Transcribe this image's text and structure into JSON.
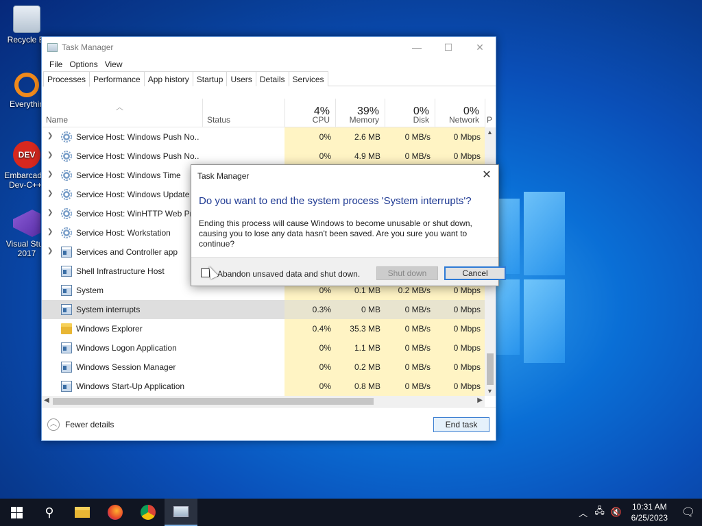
{
  "desktop": {
    "icons": [
      {
        "label": "Recycle Bi",
        "icon": "recycle-bin-icon"
      },
      {
        "label": "Everythin",
        "icon": "everything-search-icon"
      },
      {
        "label": "Embarcade Dev-C++",
        "icon": "devcpp-icon"
      },
      {
        "label": "Visual Stud 2017",
        "icon": "visual-studio-icon"
      }
    ]
  },
  "window": {
    "title": "Task Manager",
    "controls": {
      "minimize": "—",
      "maximize": "☐",
      "close": "✕"
    },
    "menu": [
      "File",
      "Options",
      "View"
    ],
    "tabs": [
      "Processes",
      "Performance",
      "App history",
      "Startup",
      "Users",
      "Details",
      "Services"
    ],
    "active_tab": "Processes",
    "columns": {
      "name": "Name",
      "status": "Status",
      "cpu": {
        "pct": "4%",
        "label": "CPU"
      },
      "memory": {
        "pct": "39%",
        "label": "Memory"
      },
      "disk": {
        "pct": "0%",
        "label": "Disk"
      },
      "network": {
        "pct": "0%",
        "label": "Network"
      },
      "power_partial": "P"
    },
    "rows": [
      {
        "name": "Service Host: Windows Push No...",
        "icon": "gear-icon",
        "expandable": true,
        "cpu": "0%",
        "mem": "2.6 MB",
        "disk": "0 MB/s",
        "net": "0 Mbps"
      },
      {
        "name": "Service Host: Windows Push No...",
        "icon": "gear-icon",
        "expandable": true,
        "cpu": "0%",
        "mem": "4.9 MB",
        "disk": "0 MB/s",
        "net": "0 Mbps"
      },
      {
        "name": "Service Host: Windows Time",
        "icon": "gear-icon",
        "expandable": true,
        "cpu": "",
        "mem": "",
        "disk": "",
        "net": ""
      },
      {
        "name": "Service Host: Windows Update",
        "icon": "gear-icon",
        "expandable": true,
        "cpu": "",
        "mem": "",
        "disk": "",
        "net": ""
      },
      {
        "name": "Service Host: WinHTTP Web Pro",
        "icon": "gear-icon",
        "expandable": true,
        "cpu": "",
        "mem": "",
        "disk": "",
        "net": ""
      },
      {
        "name": "Service Host: Workstation",
        "icon": "gear-icon",
        "expandable": true,
        "cpu": "",
        "mem": "",
        "disk": "",
        "net": ""
      },
      {
        "name": "Services and Controller app",
        "icon": "window-icon",
        "expandable": true,
        "cpu": "",
        "mem": "",
        "disk": "",
        "net": ""
      },
      {
        "name": "Shell Infrastructure Host",
        "icon": "window-icon",
        "expandable": false,
        "cpu": "",
        "mem": "",
        "disk": "",
        "net": ""
      },
      {
        "name": "System",
        "icon": "window-icon",
        "expandable": false,
        "cpu": "0%",
        "mem": "0.1 MB",
        "disk": "0.2 MB/s",
        "net": "0 Mbps"
      },
      {
        "name": "System interrupts",
        "icon": "window-icon",
        "expandable": false,
        "selected": true,
        "cpu": "0.3%",
        "mem": "0 MB",
        "disk": "0 MB/s",
        "net": "0 Mbps"
      },
      {
        "name": "Windows Explorer",
        "icon": "folder-icon",
        "expandable": false,
        "cpu": "0.4%",
        "mem": "35.3 MB",
        "disk": "0 MB/s",
        "net": "0 Mbps"
      },
      {
        "name": "Windows Logon Application",
        "icon": "window-icon",
        "expandable": false,
        "cpu": "0%",
        "mem": "1.1 MB",
        "disk": "0 MB/s",
        "net": "0 Mbps"
      },
      {
        "name": "Windows Session Manager",
        "icon": "window-icon",
        "expandable": false,
        "cpu": "0%",
        "mem": "0.2 MB",
        "disk": "0 MB/s",
        "net": "0 Mbps"
      },
      {
        "name": "Windows Start-Up Application",
        "icon": "window-icon",
        "expandable": false,
        "cpu": "0%",
        "mem": "0.8 MB",
        "disk": "0 MB/s",
        "net": "0 Mbps"
      }
    ],
    "footer": {
      "fewer_details": "Fewer details",
      "end_task": "End task"
    }
  },
  "dialog": {
    "title": "Task Manager",
    "headline": "Do you want to end the system process 'System interrupts'?",
    "body": "Ending this process will cause Windows to become unusable or shut down, causing you to lose any data hasn't been saved. Are you sure you want to continue?",
    "checkbox_label": "Abandon unsaved data and shut down.",
    "checkbox_checked": false,
    "shutdown_button": "Shut down",
    "cancel_button": "Cancel",
    "close": "✕"
  },
  "taskbar": {
    "apps": [
      "start",
      "search",
      "file-explorer",
      "firefox",
      "chrome",
      "task-manager"
    ],
    "active_app": "task-manager",
    "clock_time": "10:31 AM",
    "clock_date": "6/25/2023"
  }
}
